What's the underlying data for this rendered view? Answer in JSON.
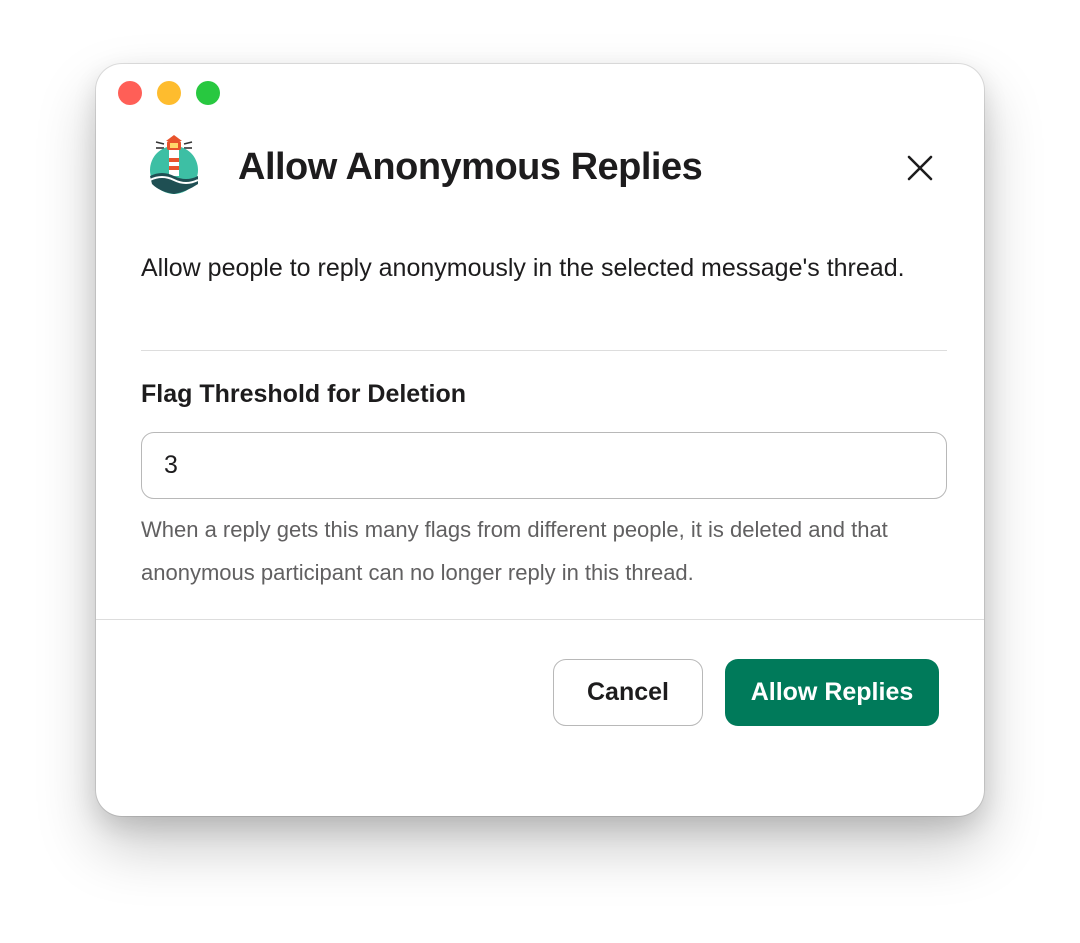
{
  "modal": {
    "title": "Allow Anonymous Replies",
    "description": "Allow people to reply anonymously in the selected message's thread.",
    "field": {
      "label": "Flag Threshold for Deletion",
      "value": "3",
      "help": "When a reply gets this many flags from different people, it is deleted and that anonymous participant can no longer reply in this thread."
    },
    "buttons": {
      "cancel": "Cancel",
      "submit": "Allow Replies"
    }
  },
  "icons": {
    "app_logo": "lighthouse-logo-icon",
    "close": "close-icon"
  },
  "colors": {
    "primary": "#007a5a",
    "text": "#1d1c1d",
    "muted_text": "#616061",
    "border": "#b8b8b8",
    "divider": "#dddddd",
    "traffic_red": "#ff5f57",
    "traffic_yellow": "#febc2e",
    "traffic_green": "#28c840"
  }
}
